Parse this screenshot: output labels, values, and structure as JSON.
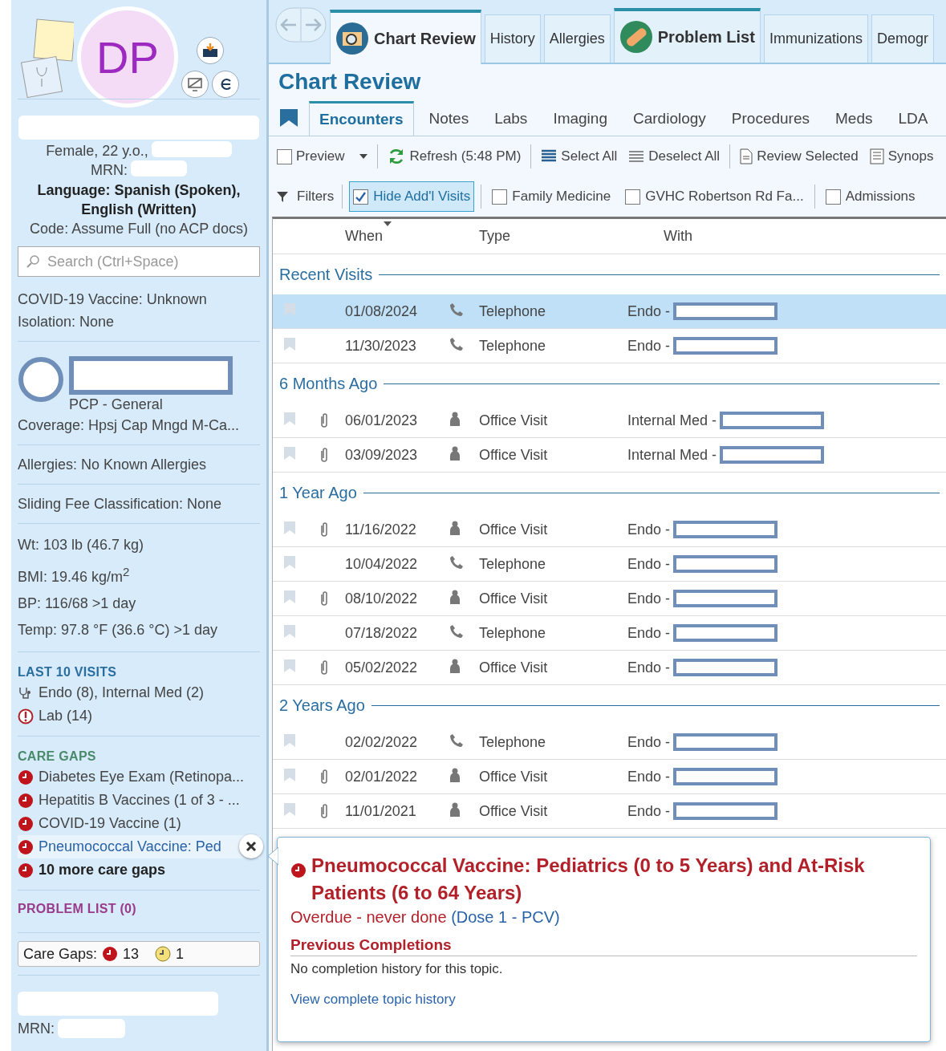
{
  "sidebar": {
    "initials": "DP",
    "demographics": [
      "Female, 22 y.o.,",
      "MRN:"
    ],
    "language": "Language: Spanish (Spoken), English (Written)",
    "code": "Code: Assume Full (no ACP docs)",
    "search": {
      "placeholder": "Search (Ctrl+Space)"
    },
    "status_lines": [
      "COVID-19 Vaccine: Unknown",
      "Isolation: None"
    ],
    "pcp": {
      "role": "PCP - General"
    },
    "coverage": "Coverage: Hpsj Cap Mngd M-Ca...",
    "allergies": "Allergies: No Known Allergies",
    "sliding_fee": "Sliding Fee Classification: None",
    "vitals": [
      "Wt:  103 lb (46.7 kg)",
      "BMI:  19.46 kg/m$^{2}$",
      "BP:  116/68 >1 day",
      "Temp:  97.8 °F (36.6 °C) >1 day"
    ],
    "last_visits": {
      "heading": "LAST 10 VISITS",
      "items": [
        {
          "kind": "specialty",
          "text": "Endo (8), Internal Med (2)"
        },
        {
          "kind": "lab",
          "text": "Lab (14)"
        }
      ]
    },
    "care_gaps": {
      "heading": "CARE GAPS",
      "items": [
        {
          "kind": "gap",
          "text": "Diabetes Eye Exam (Retinopa...",
          "selected": false
        },
        {
          "kind": "gap",
          "text": "Hepatitis B Vaccines (1 of 3 - ...",
          "selected": false
        },
        {
          "kind": "gap",
          "text": "COVID-19 Vaccine (1)",
          "selected": false
        },
        {
          "kind": "gap",
          "text": "Pneumococcal Vaccine: Ped",
          "selected": true
        },
        {
          "kind": "more",
          "text": "10 more care gaps",
          "selected": false
        }
      ]
    },
    "problem_list": {
      "heading": "PROBLEM LIST (0)"
    },
    "care_gap_summary": {
      "label": "Care Gaps:",
      "counts": [
        {
          "kind": "overdue",
          "count": "13"
        },
        {
          "kind": "due_soon",
          "count": "1"
        }
      ]
    },
    "footer": {
      "mrn_label": "MRN:"
    }
  },
  "tabs": [
    {
      "kind": "activity",
      "label": "Chart Review",
      "selected": true
    },
    {
      "kind": "plain",
      "label": "History",
      "selected": false
    },
    {
      "kind": "plain",
      "label": "Allergies",
      "selected": false
    },
    {
      "kind": "activity",
      "label": "Problem List",
      "selected": false
    },
    {
      "kind": "plain",
      "label": "Immunizations",
      "selected": false
    },
    {
      "kind": "plain",
      "label": "Demogr",
      "selected": false
    }
  ],
  "title": "Chart Review",
  "subtabs": [
    {
      "label": "Encounters",
      "selected": true
    },
    {
      "label": "Notes",
      "selected": false
    },
    {
      "label": "Labs",
      "selected": false
    },
    {
      "label": "Imaging",
      "selected": false
    },
    {
      "label": "Cardiology",
      "selected": false
    },
    {
      "label": "Procedures",
      "selected": false
    },
    {
      "label": "Meds",
      "selected": false
    },
    {
      "label": "LDA",
      "selected": false
    }
  ],
  "toolbar": [
    {
      "kind": "checkbox",
      "label": "Preview",
      "checked": false,
      "dropdown": true
    },
    {
      "kind": "refresh",
      "label": "Refresh (5:48 PM)"
    },
    {
      "kind": "select_all",
      "label": "Select All"
    },
    {
      "kind": "deselect_all",
      "label": "Deselect All"
    },
    {
      "kind": "review",
      "label": "Review Selected"
    },
    {
      "kind": "synopsis",
      "label": "Synops"
    }
  ],
  "filters": {
    "label": "Filters",
    "items": [
      {
        "label": "Hide Add'l Visits",
        "checked": true
      },
      {
        "label": "Family Medicine",
        "checked": false
      },
      {
        "label": "GVHC Robertson Rd Fa...",
        "checked": false
      },
      {
        "label": "Admissions",
        "checked": false
      }
    ]
  },
  "table": {
    "columns": [
      "When",
      "Type",
      "With"
    ],
    "groups": [
      {
        "label": "Recent Visits",
        "rows": [
          {
            "date": "01/08/2024",
            "attachment": false,
            "kind": "phone",
            "type": "Telephone",
            "with": "Endo -",
            "selected": true
          },
          {
            "date": "11/30/2023",
            "attachment": false,
            "kind": "phone",
            "type": "Telephone",
            "with": "Endo -",
            "selected": false
          }
        ]
      },
      {
        "label": "6 Months Ago",
        "rows": [
          {
            "date": "06/01/2023",
            "attachment": true,
            "kind": "person",
            "type": "Office Visit",
            "with": "Internal Med -",
            "selected": false
          },
          {
            "date": "03/09/2023",
            "attachment": true,
            "kind": "person",
            "type": "Office Visit",
            "with": "Internal Med -",
            "selected": false
          }
        ]
      },
      {
        "label": "1 Year Ago",
        "rows": [
          {
            "date": "11/16/2022",
            "attachment": true,
            "kind": "person",
            "type": "Office Visit",
            "with": "Endo -",
            "selected": false
          },
          {
            "date": "10/04/2022",
            "attachment": false,
            "kind": "phone",
            "type": "Telephone",
            "with": "Endo -",
            "selected": false
          },
          {
            "date": "08/10/2022",
            "attachment": true,
            "kind": "person",
            "type": "Office Visit",
            "with": "Endo -",
            "selected": false
          },
          {
            "date": "07/18/2022",
            "attachment": false,
            "kind": "phone",
            "type": "Telephone",
            "with": "Endo -",
            "selected": false
          },
          {
            "date": "05/02/2022",
            "attachment": true,
            "kind": "person",
            "type": "Office Visit",
            "with": "Endo -",
            "selected": false
          }
        ]
      },
      {
        "label": "2 Years Ago",
        "rows": [
          {
            "date": "02/02/2022",
            "attachment": false,
            "kind": "phone",
            "type": "Telephone",
            "with": "Endo -",
            "selected": false
          },
          {
            "date": "02/01/2022",
            "attachment": true,
            "kind": "person",
            "type": "Office Visit",
            "with": "Endo -",
            "selected": false
          },
          {
            "date": "11/01/2021",
            "attachment": true,
            "kind": "person",
            "type": "Office Visit",
            "with": "Endo -",
            "selected": false
          }
        ]
      }
    ]
  },
  "popup": {
    "title": "Pneumococcal Vaccine: Pediatrics (0 to 5 Years) and At-Risk Patients (6 to 64 Years)",
    "status": "Overdue - never done",
    "dose": "(Dose 1 - PCV)",
    "section": "Previous Completions",
    "note": "No completion history for this topic.",
    "link": "View complete topic history"
  }
}
